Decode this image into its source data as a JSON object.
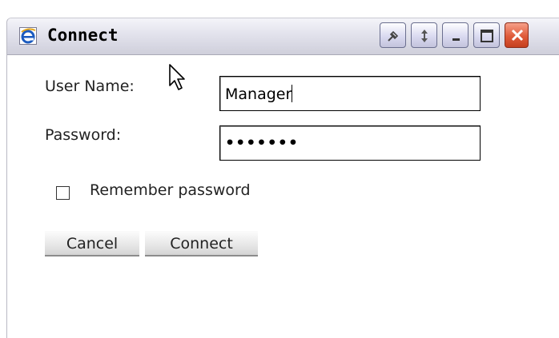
{
  "window": {
    "title": "Connect",
    "app_icon": "internet-explorer-icon",
    "title_buttons": [
      "pin-icon",
      "restore-icon",
      "minimize-icon",
      "maximize-icon",
      "close-icon"
    ]
  },
  "form": {
    "username_label": "User Name:",
    "username_value": "Manager",
    "password_label": "Password:",
    "password_value": "•••••••",
    "remember_label": "Remember password",
    "remember_checked": false,
    "cancel_label": "Cancel",
    "connect_label": "Connect"
  },
  "colors": {
    "titlebar": "#dcdce8",
    "close_button": "#df5b3a",
    "button_face": "#e6e6e6"
  }
}
